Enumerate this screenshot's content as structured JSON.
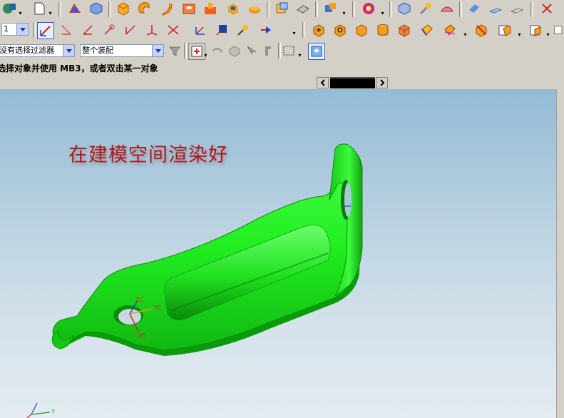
{
  "toolbar_row2": {
    "layer_combo_value": "1"
  },
  "toolbar_row3": {
    "filter_combo_value": "没有选择过滤器",
    "assembly_combo_value": "整个装配"
  },
  "cue_line": {
    "text": "选择对象并使用 MB3，或者双击某一对象"
  },
  "viewport": {
    "annotation": "在建模空间渲染好",
    "model_color": "#22ee22",
    "csys_labels": {
      "zc": "ZC",
      "yc": "YC",
      "xc": "XC"
    },
    "wcs_labels": {
      "y": "Y"
    }
  },
  "colors": {
    "toolbar_bg": "#d4d0c8",
    "annotation_red": "#b01818",
    "axis_x": "#e02020",
    "axis_y": "#e0a000",
    "axis_z": "#2040e0"
  }
}
